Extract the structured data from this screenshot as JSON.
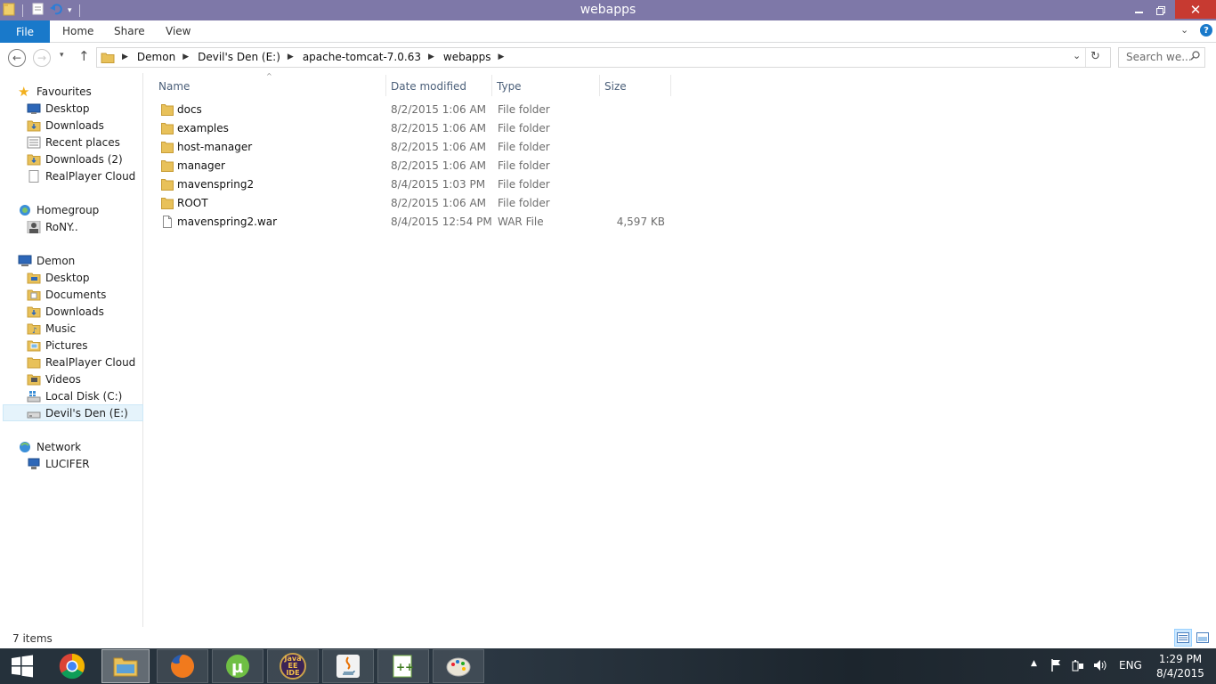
{
  "window": {
    "title": "webapps"
  },
  "ribbon": {
    "file_tab": "File",
    "tabs": [
      "Home",
      "Share",
      "View"
    ]
  },
  "address": {
    "crumbs": [
      "Demon",
      "Devil's Den (E:)",
      "apache-tomcat-7.0.63",
      "webapps"
    ]
  },
  "search": {
    "placeholder": "Search we..."
  },
  "nav": {
    "favourites": {
      "label": "Favourites",
      "items": [
        "Desktop",
        "Downloads",
        "Recent places",
        "Downloads (2)",
        "RealPlayer Cloud"
      ]
    },
    "homegroup": {
      "label": "Homegroup",
      "items": [
        "RoNY.."
      ]
    },
    "pc": {
      "label": "Demon",
      "items": [
        "Desktop",
        "Documents",
        "Downloads",
        "Music",
        "Pictures",
        "RealPlayer Cloud",
        "Videos",
        "Local Disk (C:)",
        "Devil's Den (E:)"
      ]
    },
    "network": {
      "label": "Network",
      "items": [
        "LUCIFER"
      ]
    },
    "selected": "Devil's Den (E:)"
  },
  "columns": {
    "name": "Name",
    "date": "Date modified",
    "type": "Type",
    "size": "Size"
  },
  "files": [
    {
      "name": "docs",
      "date": "8/2/2015 1:06 AM",
      "type": "File folder",
      "size": "",
      "icon": "folder-icon"
    },
    {
      "name": "examples",
      "date": "8/2/2015 1:06 AM",
      "type": "File folder",
      "size": "",
      "icon": "folder-icon"
    },
    {
      "name": "host-manager",
      "date": "8/2/2015 1:06 AM",
      "type": "File folder",
      "size": "",
      "icon": "folder-icon"
    },
    {
      "name": "manager",
      "date": "8/2/2015 1:06 AM",
      "type": "File folder",
      "size": "",
      "icon": "folder-icon"
    },
    {
      "name": "mavenspring2",
      "date": "8/4/2015 1:03 PM",
      "type": "File folder",
      "size": "",
      "icon": "folder-icon"
    },
    {
      "name": "ROOT",
      "date": "8/2/2015 1:06 AM",
      "type": "File folder",
      "size": "",
      "icon": "folder-icon"
    },
    {
      "name": "mavenspring2.war",
      "date": "8/4/2015 12:54 PM",
      "type": "WAR File",
      "size": "4,597 KB",
      "icon": "file-icon"
    }
  ],
  "status": {
    "item_count": "7 items"
  },
  "taskbar": {
    "apps": [
      "start",
      "chrome",
      "file-explorer",
      "firefox",
      "utorrent",
      "java-ee-ide",
      "java",
      "notepad-plus-plus",
      "paint"
    ],
    "java_ide_label": "Java EE IDE",
    "language": "ENG",
    "time": "1:29 PM",
    "date": "8/4/2015"
  },
  "colors": {
    "titlebar": "#7e78a8",
    "file_tab": "#1979ca",
    "close": "#c73a31",
    "selection": "#e5f3fb",
    "folder": "#e8c15a"
  }
}
